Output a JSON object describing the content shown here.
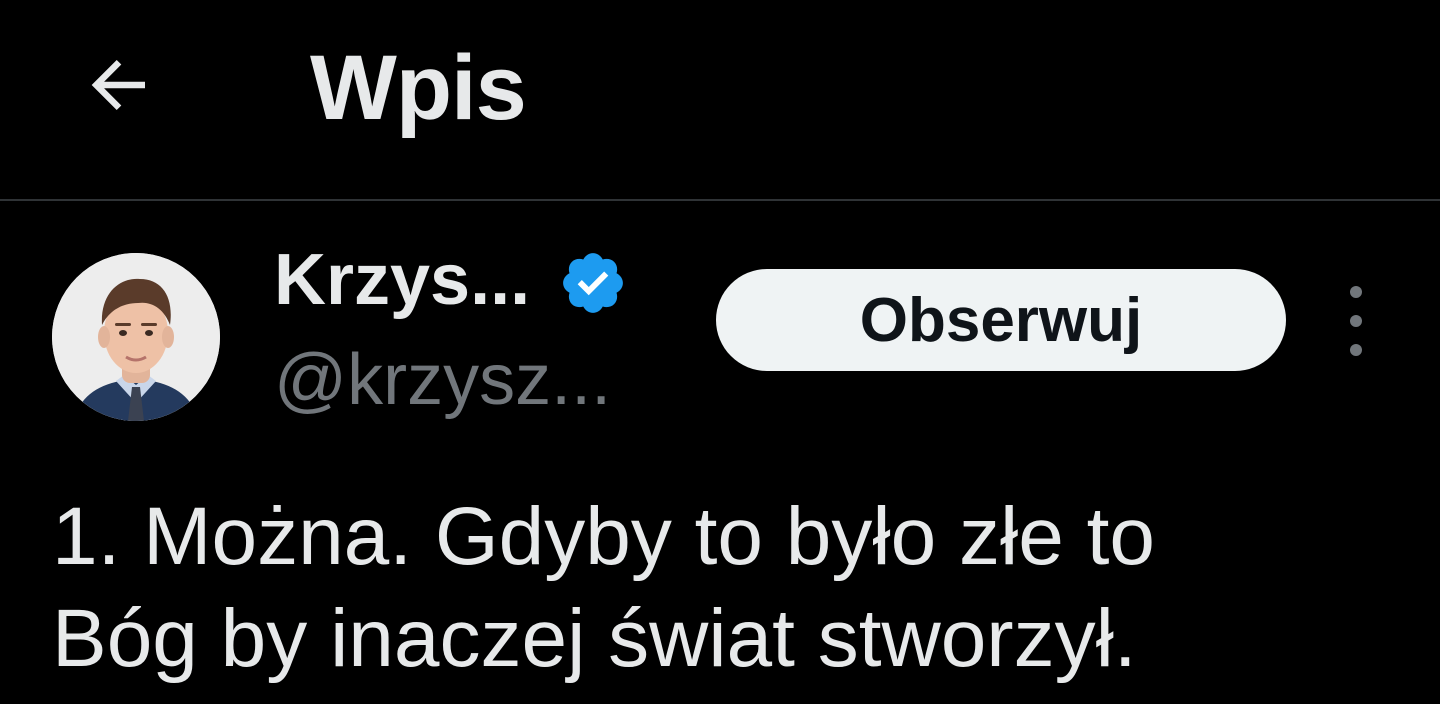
{
  "header": {
    "back_icon": "arrow-left-icon",
    "title": "Wpis"
  },
  "author": {
    "display_name": "Krzys...",
    "handle": "@krzysz...",
    "verified_icon": "verified-badge-icon",
    "verified_color": "#1d9bf0",
    "avatar_icon": "avatar-photo"
  },
  "actions": {
    "follow_label": "Obserwuj",
    "more_icon": "more-vertical-icon"
  },
  "tweet": {
    "lines": [
      "1. Można. Gdyby to było złe to",
      "Bóg by inaczej świat stworzył."
    ]
  },
  "colors": {
    "background": "#000000",
    "text_primary": "#e7e9ea",
    "text_secondary": "#71767b",
    "divider": "#2f3336",
    "button_bg": "#eff3f4",
    "button_text": "#0f1419"
  }
}
